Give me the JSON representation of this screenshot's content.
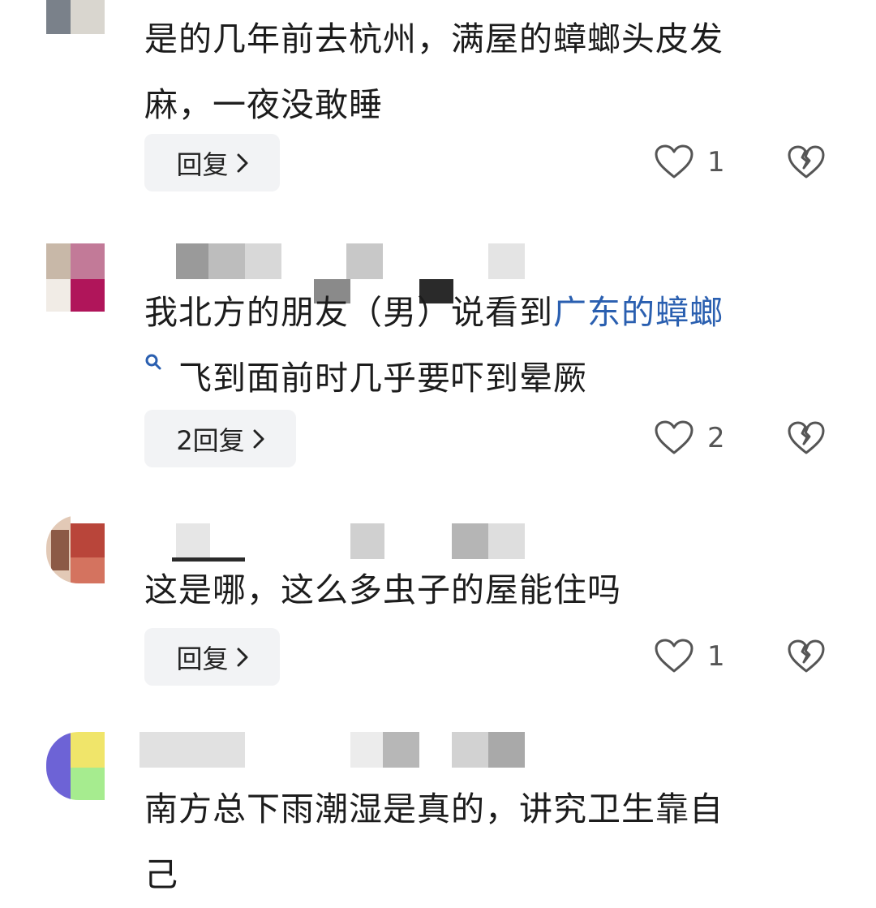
{
  "comments": [
    {
      "lines": [
        "是的几年前去杭州，满屋的蟑螂头皮发",
        "麻，一夜没敢睡"
      ],
      "reply_label": "回复",
      "likes": "1"
    },
    {
      "line1_text": "我北方的朋友（男）说看到",
      "line1_link": "广东的蟑螂",
      "line2_text": "飞到面前时几乎要吓到晕厥",
      "reply_label": "2回复",
      "likes": "2"
    },
    {
      "lines": [
        "这是哪，这么多虫子的屋能住吗"
      ],
      "reply_label": "回复",
      "likes": "1"
    },
    {
      "lines": [
        "南方总下雨潮湿是真的，讲究卫生靠自",
        "己"
      ]
    }
  ],
  "icons": {
    "like": "heart-outline-icon",
    "dislike": "broken-heart-icon",
    "chevron": "chevron-right-icon",
    "search": "search-icon"
  },
  "colors": {
    "link": "#2a5fb0",
    "reply_bg": "#f2f3f5",
    "icon": "#555555"
  }
}
